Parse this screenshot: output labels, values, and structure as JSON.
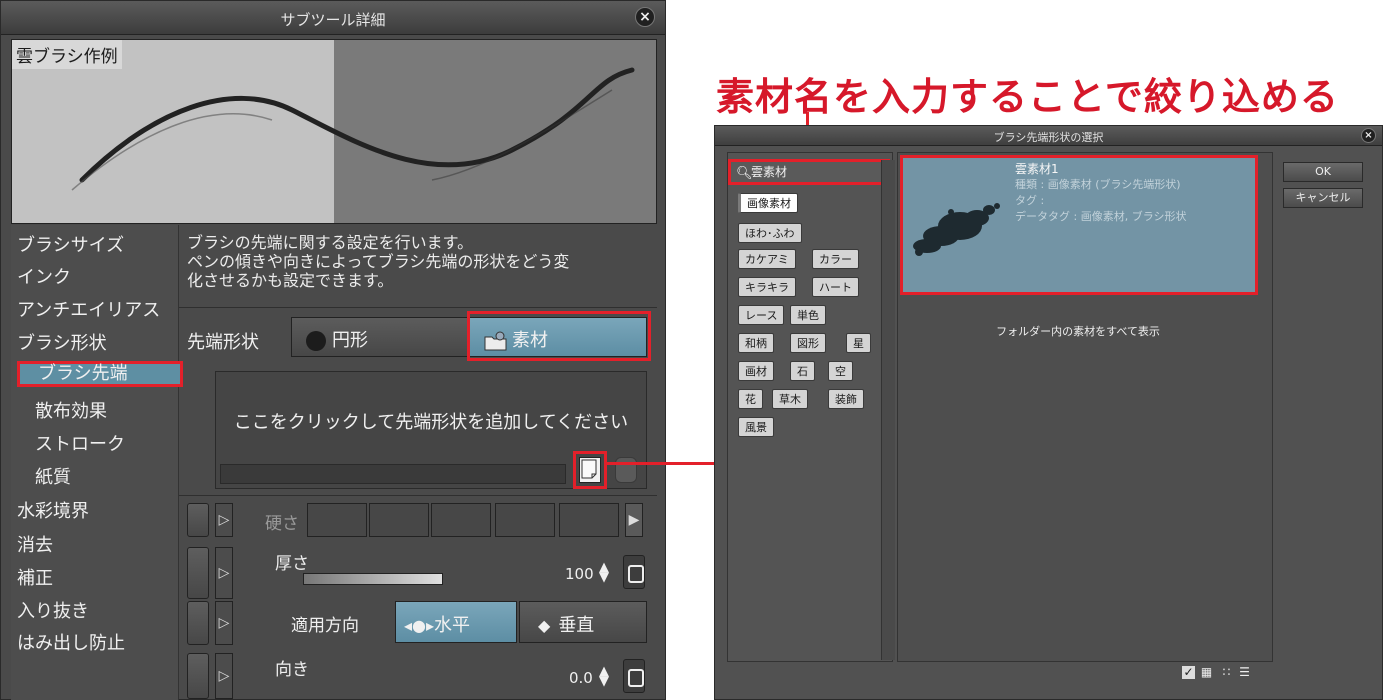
{
  "subtool_window": {
    "title": "サブツール詳細",
    "preview_label": "雲ブラシ作例",
    "categories": [
      {
        "label": "ブラシサイズ"
      },
      {
        "label": "インク"
      },
      {
        "label": "アンチエイリアス"
      },
      {
        "label": "ブラシ形状"
      },
      {
        "label": "ブラシ先端"
      },
      {
        "label": "散布効果"
      },
      {
        "label": "ストローク"
      },
      {
        "label": "紙質"
      },
      {
        "label": "水彩境界"
      },
      {
        "label": "消去"
      },
      {
        "label": "補正"
      },
      {
        "label": "入り抜き"
      },
      {
        "label": "はみ出し防止"
      }
    ],
    "description": [
      "ブラシの先端に関する設定を行います。",
      "ペンの傾きや向きによってブラシ先端の形状をどう変",
      "化させるかも設定できます。"
    ],
    "tip_shape_label": "先端形状",
    "circle_option": "円形",
    "material_option": "素材",
    "add_tip_hint": "ここをクリックして先端形状を追加してください",
    "hardness_label": "硬さ",
    "thickness_label": "厚さ",
    "thickness_value": "100",
    "apply_direction_label": "適用方向",
    "horizontal_option": "水平",
    "vertical_option": "垂直",
    "direction_label": "向き",
    "direction_value": "0.0"
  },
  "headline": "素材名を入力することで絞り込める",
  "selector_window": {
    "title": "ブラシ先端形状の選択",
    "search_text": "雲素材",
    "tags": [
      "画像素材",
      "ほわ･ふわ",
      "カケアミ",
      "カラー",
      "キラキラ",
      "ハート",
      "レース",
      "単色",
      "和柄",
      "図形",
      "星",
      "画材",
      "石",
      "空",
      "花",
      "草木",
      "装飾",
      "風景"
    ],
    "material": {
      "name": "雲素材1",
      "type_line": "種類 : 画像素材 (ブラシ先端形状)",
      "tag_line": "タグ :",
      "datatag_line": "データタグ : 画像素材, ブラシ形状"
    },
    "show_all": "フォルダー内の素材をすべて表示",
    "ok_button": "OK",
    "cancel_button": "キャンセル"
  }
}
